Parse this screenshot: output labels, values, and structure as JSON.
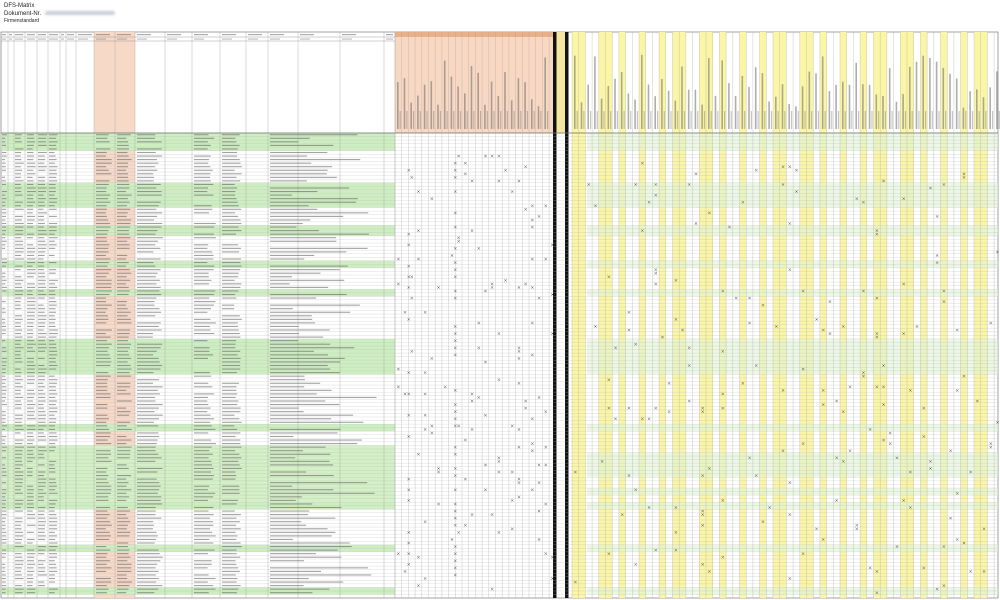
{
  "document": {
    "title": "DFS-Matrix",
    "line2": "Dokument-Nr.",
    "line3": "Firmenstandard"
  },
  "table": {
    "column_headers": {
      "nr": "Nr.",
      "group_left": "Kürzel",
      "group_mid": "Zuordnung zu Funktionseinheiten / Anlage",
      "group_right_note": "Bemerkung zur Auswahl",
      "group_orange": "Bezeichnung Anlagenteil",
      "group_black": "Status"
    },
    "marker": "X",
    "rows": [
      {
        "nr": "1",
        "code": "01 / 000",
        "label": "Magnetventil Zuluft",
        "desc": "Steuersignal Ventil A / Rückmeldung"
      },
      {
        "nr": "2",
        "code": "01 / 010",
        "label": "Magnetventil Abluft",
        "desc": "Steuersignal Ventil B / Rückmeldung"
      },
      {
        "nr": "3",
        "code": "01 / 020",
        "label": "Drucksensor 1",
        "desc": "Analogwert Druck Eingang"
      },
      {
        "nr": "4",
        "code": "01 / 030",
        "label": "Drucksensor 2",
        "desc": "Analogwert Druck Ausgang"
      },
      {
        "nr": "5",
        "code": "02 / 000",
        "label": "Temperaturfühler",
        "desc": "Messwert Temperatur"
      },
      {
        "nr": "6",
        "code": "02 / 010",
        "label": "Motorschutz",
        "desc": "Störmeldung Motor"
      },
      {
        "nr": "7",
        "code": "02 / 020",
        "label": "Frequenzumrichter",
        "desc": "Sollwert / Istwert Drehzahl"
      },
      {
        "nr": "8",
        "code": "02 / 030",
        "label": "Endschalter oben",
        "desc": "Digitaleingang Position"
      },
      {
        "nr": "9",
        "code": "02 / 040",
        "label": "Endschalter unten",
        "desc": "Digitaleingang Position"
      },
      {
        "nr": "10",
        "code": "03 / 000",
        "label": "Füllstandssensor",
        "desc": "Analogwert Füllstand"
      }
    ]
  }
}
